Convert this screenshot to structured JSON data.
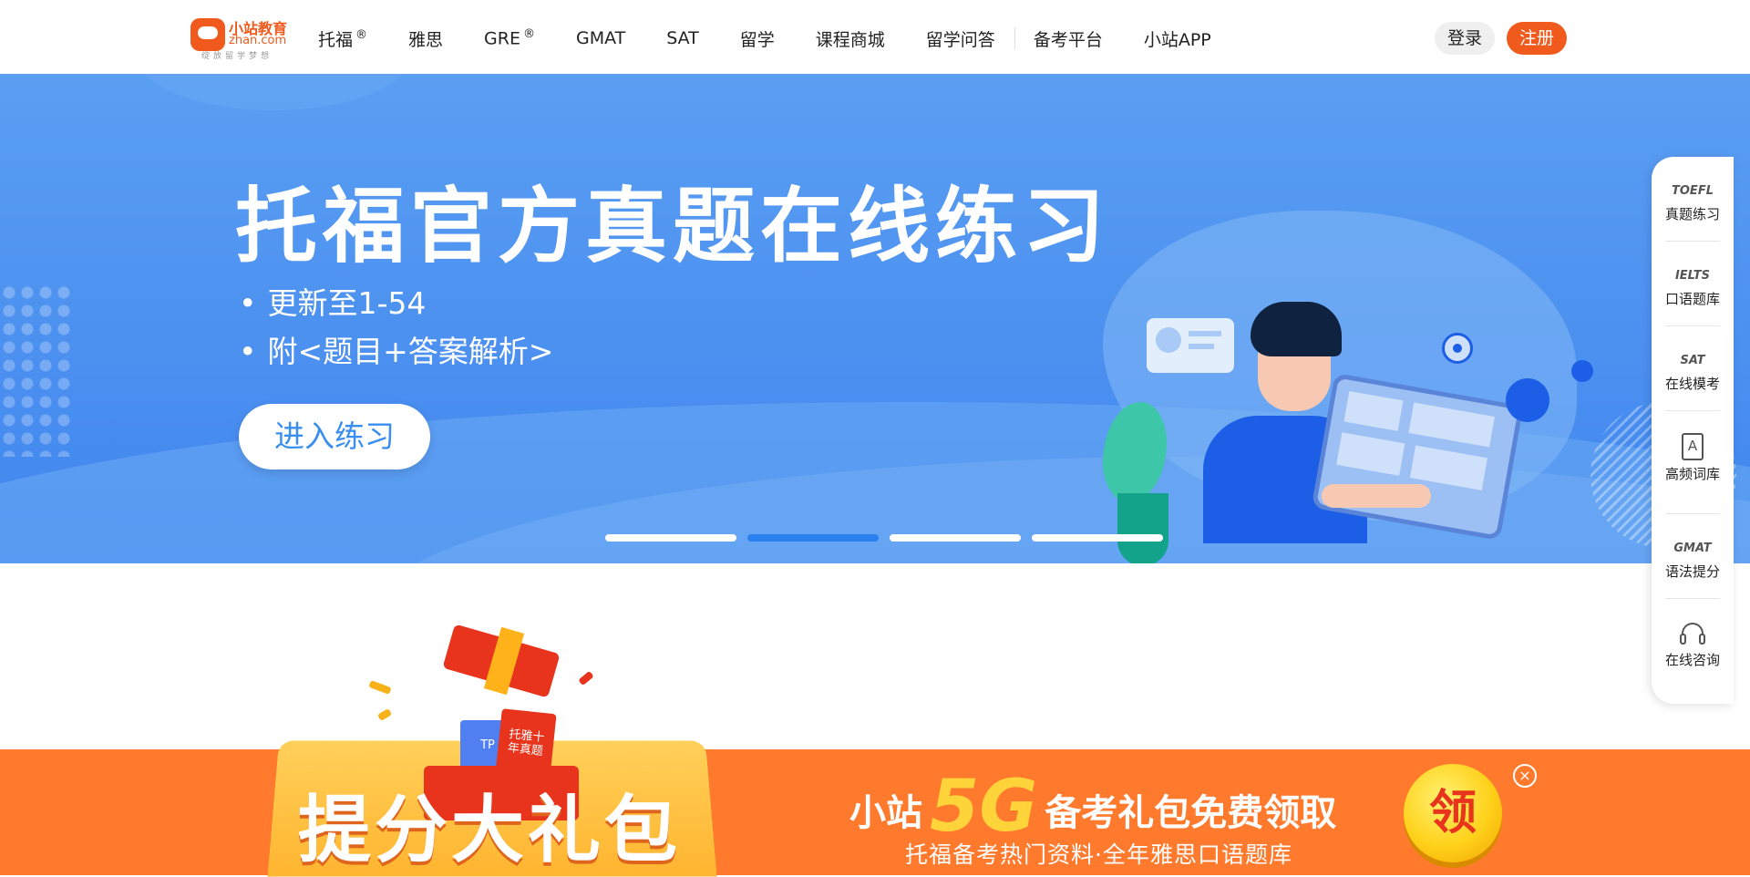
{
  "header": {
    "logo": {
      "cn": "小站教育",
      "en": "zhan.com",
      "slogan": "绽放留学梦想"
    },
    "nav": [
      {
        "label": "托福",
        "sup": "®"
      },
      {
        "label": "雅思",
        "sup": ""
      },
      {
        "label": "GRE",
        "sup": "®"
      },
      {
        "label": "GMAT",
        "sup": ""
      },
      {
        "label": "SAT",
        "sup": ""
      },
      {
        "label": "留学",
        "sup": ""
      },
      {
        "label": "课程商城",
        "sup": ""
      },
      {
        "label": "留学问答",
        "sup": ""
      },
      {
        "label": "备考平台",
        "sup": ""
      },
      {
        "label": "小站APP",
        "sup": ""
      }
    ],
    "login_label": "登录",
    "register_label": "注册"
  },
  "banner": {
    "title": "托福官方真题在线练习",
    "bullets": [
      "更新至1-54",
      "附<题目+答案解析>"
    ],
    "cta_label": "进入练习",
    "slides_total": 4,
    "active_slide": 2
  },
  "gift": {
    "book_tag_blue": "TP",
    "book_tag_red": "托雅十年真题"
  },
  "promo": {
    "big_text": "提分大礼包",
    "headline_pre": "小站",
    "headline_5g": "5G",
    "headline_post": "备考礼包免费领取",
    "subline": "托福备考热门资料·全年雅思口语题库",
    "claim_label": "领",
    "close_label": "×"
  },
  "sidebar": {
    "items": [
      {
        "top": "TOEFL",
        "label": "真题练习",
        "icon": ""
      },
      {
        "top": "IELTS",
        "label": "口语题库",
        "icon": ""
      },
      {
        "top": "SAT",
        "label": "在线模考",
        "icon": ""
      },
      {
        "top": "A",
        "label": "高频词库",
        "icon": "vocab-book-icon"
      },
      {
        "top": "GMAT",
        "label": "语法提分",
        "icon": ""
      },
      {
        "top": "",
        "label": "在线咨询",
        "icon": "headset-icon"
      }
    ]
  },
  "colors": {
    "brand_orange": "#f05a1c",
    "banner_blue": "#4b8ff0",
    "active_dot": "#2b80f0",
    "promo_orange": "#ff7a2d",
    "promo_yellow": "#ffd33a"
  }
}
